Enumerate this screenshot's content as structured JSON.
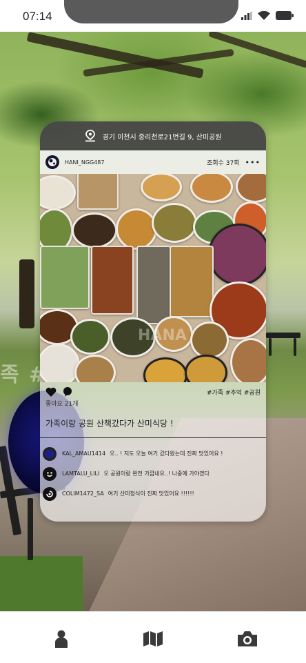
{
  "status_bar": {
    "time": "07:14",
    "icons": [
      "signal-icon",
      "wifi-icon",
      "battery-icon"
    ]
  },
  "background": {
    "overlay_text": "족 #"
  },
  "post": {
    "location": "경기 이천시 중리천로21번길 9, 산미공원",
    "username": "HANI_NGG487",
    "views": "조회수 37회",
    "more_label": "•••",
    "tags": "#가족 #추억 #공원",
    "likes": "좋아요 21개",
    "caption": "가족이랑 공원 산책갔다가 산미식당 !",
    "watermark": "HANA"
  },
  "comments": [
    {
      "user": "KAL_AMAU1414",
      "text": "오.. ! 저도 오늘 여기 갔다왔는데 진짜 맛있어요 !"
    },
    {
      "user": "LAMTALU_LILI",
      "text": "오 공원이랑 완전 가깝네요..! 나중에 가야겠다"
    },
    {
      "user": "COLIM1472_SA",
      "text": "여기 산미정식이 진짜 맛있어요 !!!!!!"
    }
  ],
  "bottom_nav": {
    "items": [
      "profile-icon",
      "map-icon",
      "camera-icon"
    ]
  },
  "colors": {
    "location_bar": "#373737",
    "nav_icon": "#3a3a3a"
  }
}
